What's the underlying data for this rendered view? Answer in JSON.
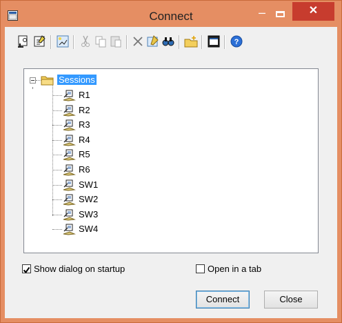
{
  "window": {
    "title": "Connect"
  },
  "toolbar": {
    "icons": [
      "new-session-icon",
      "properties-icon",
      "create-shortcut-icon",
      "cut-icon",
      "copy-icon",
      "paste-icon",
      "delete-icon",
      "rename-icon",
      "find-icon",
      "new-folder-icon",
      "connect-terminal-icon",
      "help-icon"
    ]
  },
  "tree": {
    "root": "Sessions",
    "items": [
      "R1",
      "R2",
      "R3",
      "R4",
      "R5",
      "R6",
      "SW1",
      "SW2",
      "SW3",
      "SW4"
    ]
  },
  "options": {
    "show_dialog": {
      "label": "Show dialog on startup",
      "checked": true
    },
    "open_in_tab": {
      "label": "Open in a tab",
      "checked": false
    }
  },
  "buttons": {
    "connect": "Connect",
    "close": "Close"
  },
  "colors": {
    "titlebar": "#e58e63",
    "close": "#c73c2e",
    "selection": "#3399ff"
  }
}
